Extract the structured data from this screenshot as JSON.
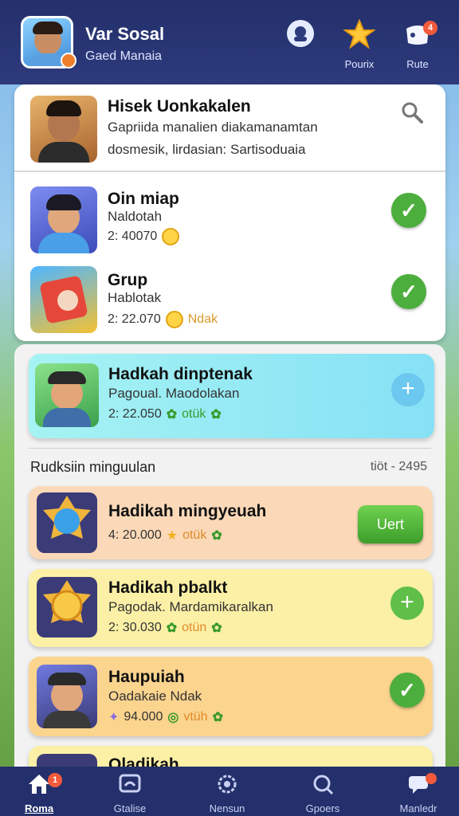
{
  "header": {
    "title": "Var Sosal",
    "subtitle": "Gaed Manaia",
    "icons": [
      {
        "icon": "chat-bubble-icon",
        "label": ""
      },
      {
        "icon": "star-icon",
        "label": "Pourix"
      },
      {
        "icon": "gift-icon",
        "label": "Rute",
        "badge": "4"
      }
    ]
  },
  "top_card": {
    "title": "Hisek Uonkakalen",
    "line1": "Gapriida manalien diakamanamtan",
    "line2": "dosmesik, lirdasian: Sartisoduaia"
  },
  "friends": [
    {
      "title": "Oin miap",
      "sub": "Naldotah",
      "meta": "2: 40070"
    },
    {
      "title": "Grup",
      "sub": "Hablotak",
      "meta": "2: 22.070",
      "meta_tag": "Ndak"
    }
  ],
  "highlight": {
    "title": "Hadkah dinptenak",
    "sub": "Pagoual. Maodolakan",
    "meta": "2: 22.050",
    "meta_tag": "otük"
  },
  "section": {
    "label": "Rudksiin minguulan",
    "time": "tiöt - 2495"
  },
  "rewards": [
    {
      "title": "Hadikah mingyeuah",
      "sub": "",
      "meta": "4: 20.000",
      "meta_tag": "otük",
      "action": "Uert"
    },
    {
      "title": "Hadikah pbalkt",
      "sub": "Pagodak. Mardamikaralkan",
      "meta": "2: 30.030",
      "meta_tag": "otün"
    },
    {
      "title": "Haupuiah",
      "sub": "Oadakaie Ndak",
      "meta": "94.000",
      "meta_tag": "vtüh"
    },
    {
      "title": "Oladikah"
    }
  ],
  "nav": [
    {
      "label": "Roma",
      "badge": "1"
    },
    {
      "label": "Gtalise"
    },
    {
      "label": "Nensun"
    },
    {
      "label": "Gpoers"
    },
    {
      "label": "Manledr"
    }
  ]
}
